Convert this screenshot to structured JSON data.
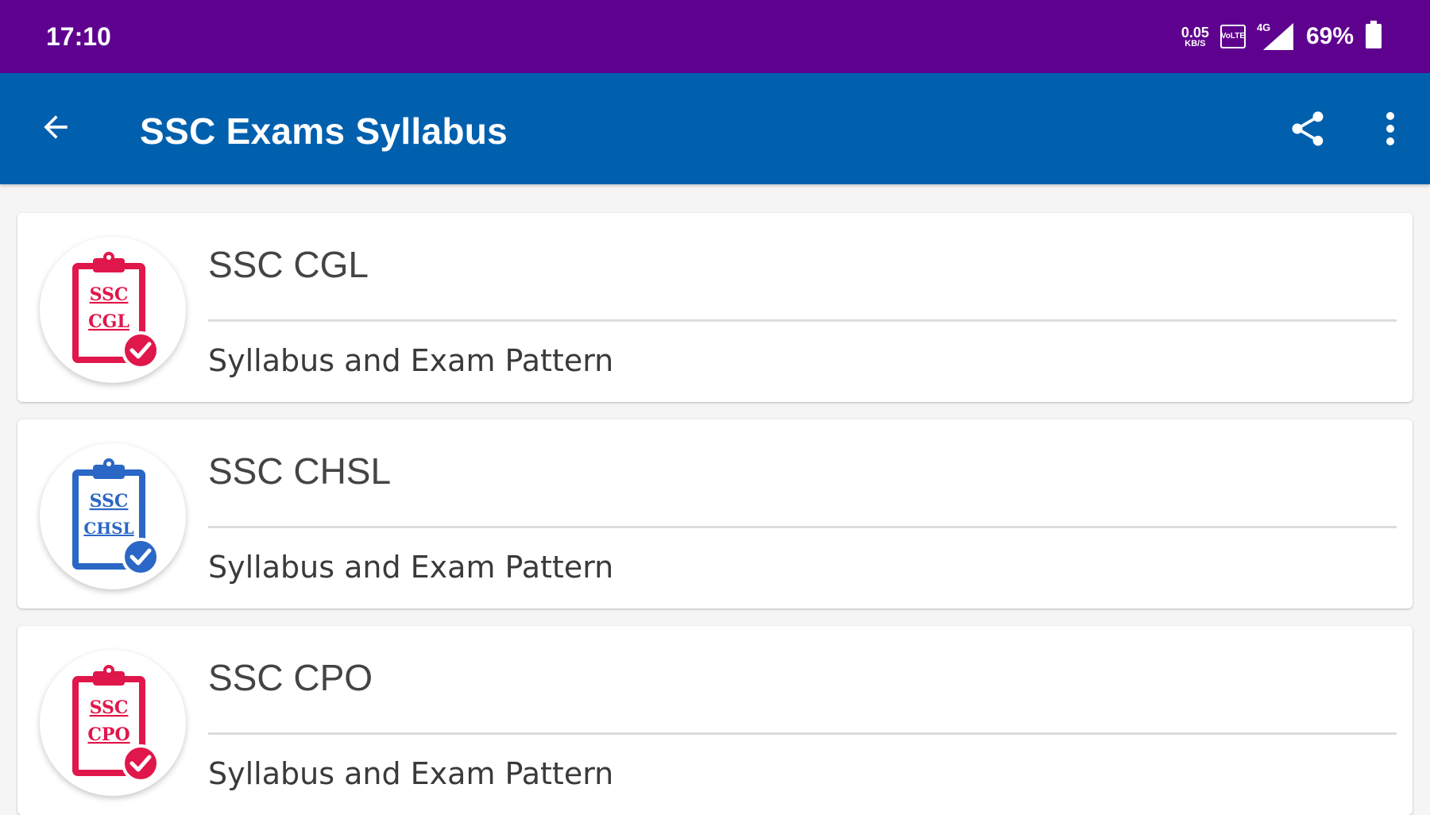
{
  "status_bar": {
    "time": "17:10",
    "net_speed_value": "0.05",
    "net_speed_unit": "KB/S",
    "volte_label": "VoLTE",
    "network_label": "4G",
    "battery": "69%"
  },
  "app_bar": {
    "title": "SSC Exams Syllabus",
    "back_icon": "arrow-back-icon",
    "share_icon": "share-icon",
    "more_icon": "more-vert-icon"
  },
  "exams": [
    {
      "title": "SSC CGL",
      "subtitle": "Syllabus and Exam Pattern",
      "icon_line1": "SSC",
      "icon_line2": "CGL",
      "icon_color": "#e0174a"
    },
    {
      "title": "SSC CHSL",
      "subtitle": "Syllabus and Exam Pattern",
      "icon_line1": "SSC",
      "icon_line2": "CHSL",
      "icon_color": "#2a67c6"
    },
    {
      "title": "SSC CPO",
      "subtitle": "Syllabus and Exam Pattern",
      "icon_line1": "SSC",
      "icon_line2": "CPO",
      "icon_color": "#e0174a"
    }
  ],
  "colors": {
    "status_bar": "#5f018f",
    "app_bar": "#0060ae",
    "background": "#f5f5f5"
  }
}
